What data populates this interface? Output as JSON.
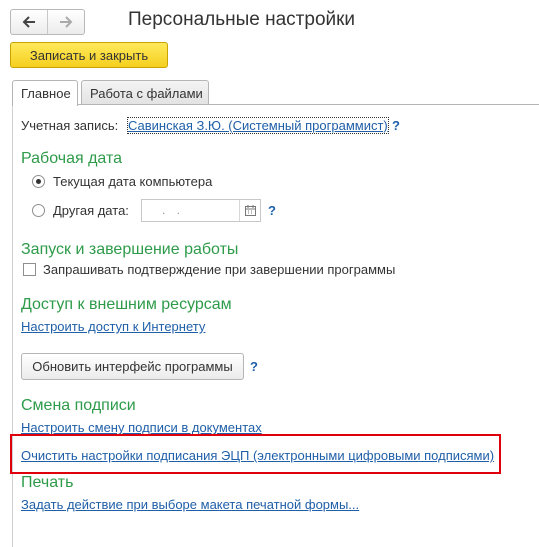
{
  "window": {
    "title": "Персональные настройки"
  },
  "nav": {
    "back_icon": "arrow-left-icon",
    "forward_icon": "arrow-right-icon"
  },
  "toolbar": {
    "save_close_label": "Записать и закрыть"
  },
  "tabs": [
    {
      "label": "Главное",
      "active": true
    },
    {
      "label": "Работа с файлами",
      "active": false
    }
  ],
  "account": {
    "label": "Учетная запись:",
    "value": "Савинская З.Ю. (Системный программист)",
    "help": "?"
  },
  "work_date": {
    "title": "Рабочая дата",
    "option_current": "Текущая дата компьютера",
    "option_other": "Другая дата:",
    "date_placeholder": ". .",
    "help": "?",
    "selected": "current"
  },
  "startup": {
    "title": "Запуск и завершение работы",
    "confirm_exit_label": "Запрашивать подтверждение при завершении программы",
    "confirm_exit_checked": false
  },
  "external": {
    "title": "Доступ к внешним ресурсам",
    "internet_link": "Настроить доступ к Интернету"
  },
  "refresh": {
    "button_label": "Обновить интерфейс программы",
    "help": "?"
  },
  "signature": {
    "title": "Смена подписи",
    "change_link": "Настроить смену подписи в документах",
    "clear_link": "Очистить настройки подписания ЭЦП (электронными цифровыми подписями)"
  },
  "print": {
    "title": "Печать",
    "action_link": "Задать действие при выборе макета печатной формы..."
  },
  "colors": {
    "section_title": "#2e9b4a",
    "link": "#1f5fa8",
    "primary_button": "#f5cf1e",
    "highlight": "#e0000c"
  }
}
